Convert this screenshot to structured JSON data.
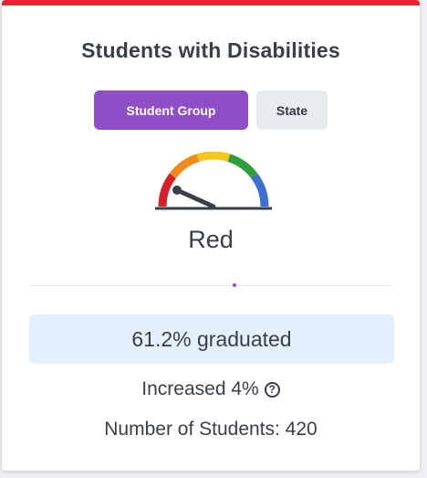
{
  "card": {
    "title": "Students with Disabilities",
    "accent_color": "#e0262e"
  },
  "toggle": {
    "student_group_label": "Student Group",
    "state_label": "State",
    "active_color": "#8e4fc6",
    "inactive_color": "#e8ebef",
    "selected": "Student Group"
  },
  "gauge": {
    "status": "Red",
    "segment_colors": [
      "#d61f28",
      "#f08a1c",
      "#f7c61a",
      "#2f9e3e",
      "#3b6fd1"
    ],
    "needle_color": "#3a3f47"
  },
  "metrics": {
    "graduation_rate": "61.2% graduated",
    "change_text": "Increased 4%",
    "info_icon": "?",
    "student_count": "Number of Students: 420",
    "highlight_bg": "#e4f0fd"
  }
}
